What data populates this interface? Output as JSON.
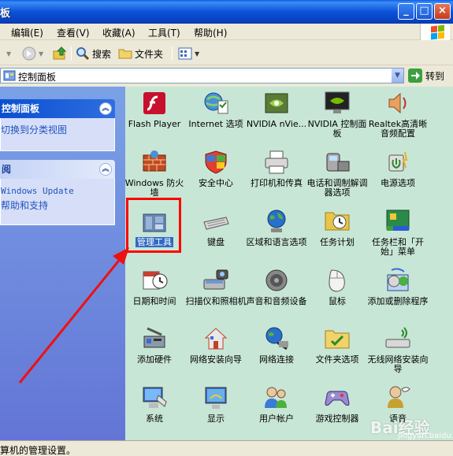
{
  "window": {
    "title": "板"
  },
  "menu": [
    {
      "label": "编辑(E)"
    },
    {
      "label": "查看(V)"
    },
    {
      "label": "收藏(A)"
    },
    {
      "label": "工具(T)"
    },
    {
      "label": "帮助(H)"
    }
  ],
  "toolbar": {
    "search_label": "搜索",
    "folders_label": "文件夹"
  },
  "address": {
    "value": "控制面板",
    "go_label": "转到"
  },
  "sidebar": {
    "control_panel": {
      "title": "控制面板",
      "link": "切换到分类视图"
    },
    "see_also": {
      "title": "阅",
      "links": [
        "Windows Update",
        "帮助和支持"
      ]
    }
  },
  "items": [
    {
      "label": "Flash Player",
      "icon": "flash-icon"
    },
    {
      "label": "Internet 选项",
      "icon": "internet-options-icon"
    },
    {
      "label": "NVIDIA nVie...",
      "icon": "nvidia-nview-icon"
    },
    {
      "label": "NVIDIA 控制面板",
      "icon": "nvidia-control-panel-icon"
    },
    {
      "label": "Realtek高清晰音频配置",
      "icon": "realtek-audio-icon"
    },
    {
      "label": "Windows 防火墙",
      "icon": "firewall-icon"
    },
    {
      "label": "安全中心",
      "icon": "security-center-icon"
    },
    {
      "label": "打印机和传真",
      "icon": "printer-icon"
    },
    {
      "label": "电话和调制解调器选项",
      "icon": "phone-modem-icon"
    },
    {
      "label": "电源选项",
      "icon": "power-icon"
    },
    {
      "label": "管理工具",
      "icon": "admin-tools-icon"
    },
    {
      "label": "键盘",
      "icon": "keyboard-icon"
    },
    {
      "label": "区域和语言选项",
      "icon": "globe-icon"
    },
    {
      "label": "任务计划",
      "icon": "scheduled-tasks-icon"
    },
    {
      "label": "任务栏和「开始」菜单",
      "icon": "taskbar-icon"
    },
    {
      "label": "日期和时间",
      "icon": "clock-icon"
    },
    {
      "label": "扫描仪和照相机",
      "icon": "scanner-icon"
    },
    {
      "label": "声音和音频设备",
      "icon": "speaker-icon"
    },
    {
      "label": "鼠标",
      "icon": "mouse-icon"
    },
    {
      "label": "添加或删除程序",
      "icon": "add-remove-programs-icon"
    },
    {
      "label": "添加硬件",
      "icon": "add-hardware-icon"
    },
    {
      "label": "网络安装向导",
      "icon": "network-setup-icon"
    },
    {
      "label": "网络连接",
      "icon": "network-connections-icon"
    },
    {
      "label": "文件夹选项",
      "icon": "folder-options-icon"
    },
    {
      "label": "无线网络安装向导",
      "icon": "wireless-icon"
    },
    {
      "label": "系统",
      "icon": "system-icon"
    },
    {
      "label": "显示",
      "icon": "display-icon"
    },
    {
      "label": "用户帐户",
      "icon": "user-accounts-icon"
    },
    {
      "label": "游戏控制器",
      "icon": "game-controller-icon"
    },
    {
      "label": "语音",
      "icon": "speech-icon"
    }
  ],
  "status": {
    "text": "算机的管理设置。"
  },
  "watermark": {
    "brand": "Bai经验",
    "sub": "jingyan.baidu.com"
  },
  "colors": {
    "accent": "#316ac5",
    "highlight": "#ff0000",
    "pane": "#c8e6d6"
  }
}
